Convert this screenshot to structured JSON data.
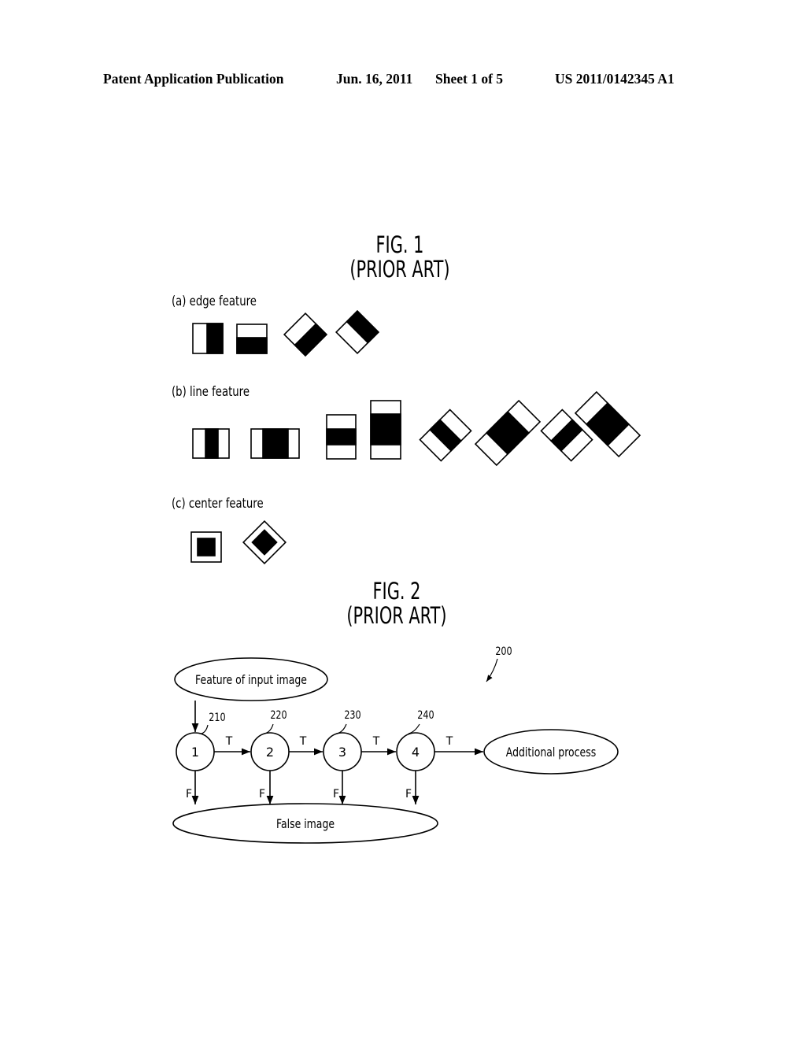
{
  "header": {
    "publication": "Patent Application Publication",
    "date": "Jun. 16, 2011",
    "sheet": "Sheet 1 of 5",
    "number": "US 2011/0142345 A1"
  },
  "fig1": {
    "title": "FIG. 1",
    "subtitle": "(PRIOR ART)",
    "sections": {
      "edge": "(a) edge feature",
      "line": "(b) line feature",
      "center": "(c) center feature"
    }
  },
  "fig2": {
    "title": "FIG. 2",
    "subtitle": "(PRIOR ART)",
    "ref_main": "200",
    "input_node": "Feature of input image",
    "output_node": "Additional process",
    "false_node": "False image",
    "stages": [
      {
        "label": "1",
        "ref": "210"
      },
      {
        "label": "2",
        "ref": "220"
      },
      {
        "label": "3",
        "ref": "230"
      },
      {
        "label": "4",
        "ref": "240"
      }
    ],
    "true_label": "T",
    "false_label": "F"
  }
}
